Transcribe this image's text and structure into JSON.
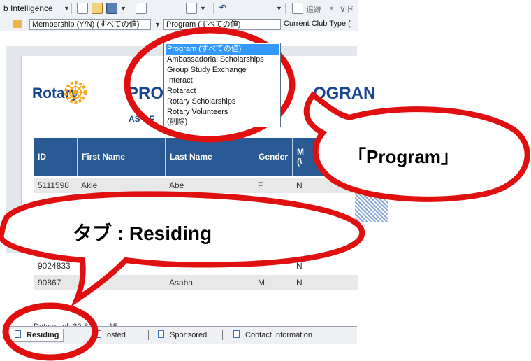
{
  "toolbar": {
    "app_menu_label": "b Intelligence",
    "tracking_label": "追跡",
    "filter_membership": "Membership (Y/N) (すべての値)",
    "filter_program": "Program (すべての値)",
    "filter_club_type": "Current Club Type ("
  },
  "program_dropdown": {
    "options": [
      "Program (すべての値)",
      "Ambassadorial Scholarships",
      "Group Study Exchange",
      "Interact",
      "Rotaract",
      "Rotary Scholarships",
      "Rotary Volunteers",
      "(削除)"
    ],
    "selected_index": 0
  },
  "report": {
    "logo_text": "Rotary",
    "title_left": "PRO",
    "title_right": "OGRAN",
    "subtitle": "AS OF",
    "columns": [
      "ID",
      "First Name",
      "Last Name",
      "Gender",
      "M\n(\\"
    ],
    "rows": [
      {
        "id": "5111598",
        "first": "Akie",
        "last": "Abe",
        "gender": "F",
        "m": "N"
      },
      {
        "id": "9024833",
        "first": "",
        "last": "",
        "gender": "",
        "m": "N"
      },
      {
        "id": "90867",
        "first": "",
        "last": "Asaba",
        "gender": "M",
        "m": "N"
      }
    ],
    "data_as_of": "Data as of: 30-8 月 ... 15"
  },
  "tabs": [
    {
      "label": "Residing",
      "active": true
    },
    {
      "label": "osted",
      "active": false
    },
    {
      "label": "Sponsored",
      "active": false
    },
    {
      "label": "Contact Information",
      "active": false
    }
  ],
  "callouts": {
    "program": "「Program」",
    "tab": "タブ : Residing"
  },
  "colors": {
    "accent_red": "#e01010",
    "header_blue": "#2a5a94",
    "selection_blue": "#3399ff",
    "rotary_blue": "#17458f",
    "rotary_gold": "#f7a81b"
  }
}
